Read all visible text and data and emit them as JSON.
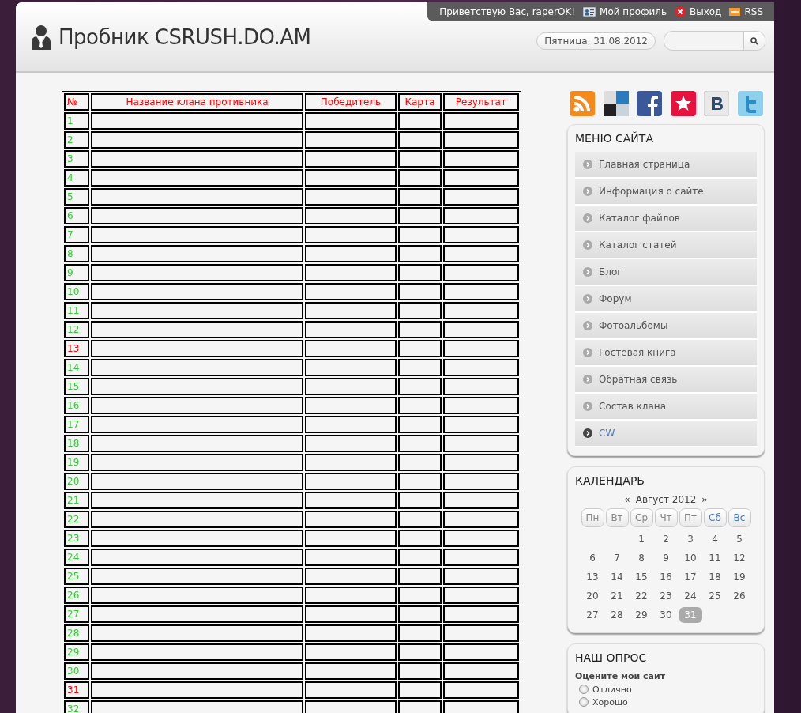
{
  "top_bar": {
    "greeting": "Приветствую Вас, raperOK!",
    "links": [
      {
        "kind": "profile",
        "label": "Мой профиль"
      },
      {
        "kind": "logout",
        "label": "Выход"
      },
      {
        "kind": "rss",
        "label": "RSS"
      }
    ]
  },
  "header": {
    "title": "Пробник CSRUSH.DO.AM",
    "date": "Пятница, 31.08.2012"
  },
  "table": {
    "columns": [
      "№",
      "Название клана противника",
      "Победитель",
      "Карта",
      "Результат"
    ],
    "rows": [
      {
        "number": "1",
        "color": "#33cc33"
      },
      {
        "number": "2",
        "color": "#33cc33"
      },
      {
        "number": "3",
        "color": "#33cc33"
      },
      {
        "number": "4",
        "color": "#33cc33"
      },
      {
        "number": "5",
        "color": "#33cc33"
      },
      {
        "number": "6",
        "color": "#33cc33"
      },
      {
        "number": "7",
        "color": "#33cc33"
      },
      {
        "number": "8",
        "color": "#33cc33"
      },
      {
        "number": "9",
        "color": "#33cc33"
      },
      {
        "number": "10",
        "color": "#33cc33"
      },
      {
        "number": "11",
        "color": "#33cc33"
      },
      {
        "number": "12",
        "color": "#33cc33"
      },
      {
        "number": "13",
        "color": "#ff0000"
      },
      {
        "number": "14",
        "color": "#33cc33"
      },
      {
        "number": "15",
        "color": "#33cc33"
      },
      {
        "number": "16",
        "color": "#33cc33"
      },
      {
        "number": "17",
        "color": "#33cc33"
      },
      {
        "number": "18",
        "color": "#33cc33"
      },
      {
        "number": "19",
        "color": "#33cc33"
      },
      {
        "number": "20",
        "color": "#33cc33"
      },
      {
        "number": "21",
        "color": "#33cc33"
      },
      {
        "number": "22",
        "color": "#33cc33"
      },
      {
        "number": "23",
        "color": "#33cc33"
      },
      {
        "number": "24",
        "color": "#33cc33"
      },
      {
        "number": "25",
        "color": "#33cc33"
      },
      {
        "number": "26",
        "color": "#33cc33"
      },
      {
        "number": "27",
        "color": "#33cc33"
      },
      {
        "number": "28",
        "color": "#33cc33"
      },
      {
        "number": "29",
        "color": "#33cc33"
      },
      {
        "number": "30",
        "color": "#33cc33"
      },
      {
        "number": "31",
        "color": "#ff0000"
      },
      {
        "number": "32",
        "color": "#33cc33"
      }
    ]
  },
  "social": [
    {
      "kind": "rss"
    },
    {
      "kind": "squares"
    },
    {
      "kind": "f"
    },
    {
      "kind": "star"
    },
    {
      "kind": "b"
    },
    {
      "kind": "t"
    }
  ],
  "menu": {
    "title": "МЕНЮ САЙТА",
    "items": [
      {
        "label": "Главная страница",
        "selected": false
      },
      {
        "label": "Информация о сайте",
        "selected": false
      },
      {
        "label": "Каталог файлов",
        "selected": false
      },
      {
        "label": "Каталог статей",
        "selected": false
      },
      {
        "label": "Блог",
        "selected": false
      },
      {
        "label": "Форум",
        "selected": false
      },
      {
        "label": "Фотоальбомы",
        "selected": false
      },
      {
        "label": "Гостевая книга",
        "selected": false
      },
      {
        "label": "Обратная связь",
        "selected": false
      },
      {
        "label": "Состав клана",
        "selected": false
      },
      {
        "label": "CW",
        "selected": true
      }
    ]
  },
  "calendar": {
    "title": "КАЛЕНДАРЬ",
    "prev": "«",
    "month": "Август 2012",
    "next": "»",
    "weekdays": [
      {
        "label": "Пн",
        "weekend": false
      },
      {
        "label": "Вт",
        "weekend": false
      },
      {
        "label": "Ср",
        "weekend": false
      },
      {
        "label": "Чт",
        "weekend": false
      },
      {
        "label": "Пт",
        "weekend": false
      },
      {
        "label": "Сб",
        "weekend": true
      },
      {
        "label": "Вс",
        "weekend": true
      }
    ],
    "weeks": [
      {
        "kind": "start",
        "days": [
          {
            "label": "1",
            "selected": false
          },
          {
            "label": "2",
            "selected": false
          },
          {
            "label": "3",
            "selected": false
          },
          {
            "label": "4",
            "selected": false
          },
          {
            "label": "5",
            "selected": false
          }
        ]
      },
      {
        "kind": "full",
        "days": [
          {
            "label": "6",
            "selected": false
          },
          {
            "label": "7",
            "selected": false
          },
          {
            "label": "8",
            "selected": false
          },
          {
            "label": "9",
            "selected": false
          },
          {
            "label": "10",
            "selected": false
          },
          {
            "label": "11",
            "selected": false
          },
          {
            "label": "12",
            "selected": false
          }
        ]
      },
      {
        "kind": "full",
        "days": [
          {
            "label": "13",
            "selected": false
          },
          {
            "label": "14",
            "selected": false
          },
          {
            "label": "15",
            "selected": false
          },
          {
            "label": "16",
            "selected": false
          },
          {
            "label": "17",
            "selected": false
          },
          {
            "label": "18",
            "selected": false
          },
          {
            "label": "19",
            "selected": false
          }
        ]
      },
      {
        "kind": "full",
        "days": [
          {
            "label": "20",
            "selected": false
          },
          {
            "label": "21",
            "selected": false
          },
          {
            "label": "22",
            "selected": false
          },
          {
            "label": "23",
            "selected": false
          },
          {
            "label": "24",
            "selected": false
          },
          {
            "label": "25",
            "selected": false
          },
          {
            "label": "26",
            "selected": false
          }
        ]
      },
      {
        "kind": "full",
        "days": [
          {
            "label": "27",
            "selected": false
          },
          {
            "label": "28",
            "selected": false
          },
          {
            "label": "29",
            "selected": false
          },
          {
            "label": "30",
            "selected": false
          },
          {
            "label": "31",
            "selected": true
          }
        ]
      }
    ]
  },
  "poll": {
    "title": "НАШ ОПРОС",
    "question": "Оцените мой сайт",
    "options": [
      {
        "label": "Отлично",
        "selected": false
      },
      {
        "label": "Хорошо",
        "selected": false
      }
    ]
  }
}
